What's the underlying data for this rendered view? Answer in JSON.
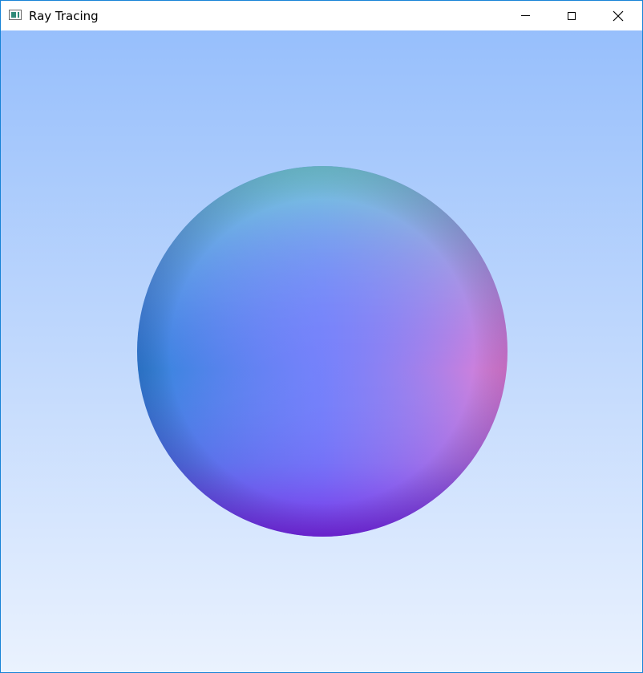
{
  "window": {
    "title": "Ray Tracing",
    "icon": "app-window-icon"
  },
  "controls": {
    "minimize_icon": "minimize-icon",
    "maximize_icon": "maximize-icon",
    "close_icon": "close-icon"
  },
  "colors": {
    "sky_top": "#97bffc",
    "sky_bottom": "#eaf2fe",
    "sphere_top": "#76e3cd",
    "sphere_left": "#2b86d7",
    "sphere_right": "#f07fd0",
    "sphere_center": "#7c84fc",
    "sphere_bottom": "#7a1fe0",
    "window_border": "#1883d7"
  }
}
